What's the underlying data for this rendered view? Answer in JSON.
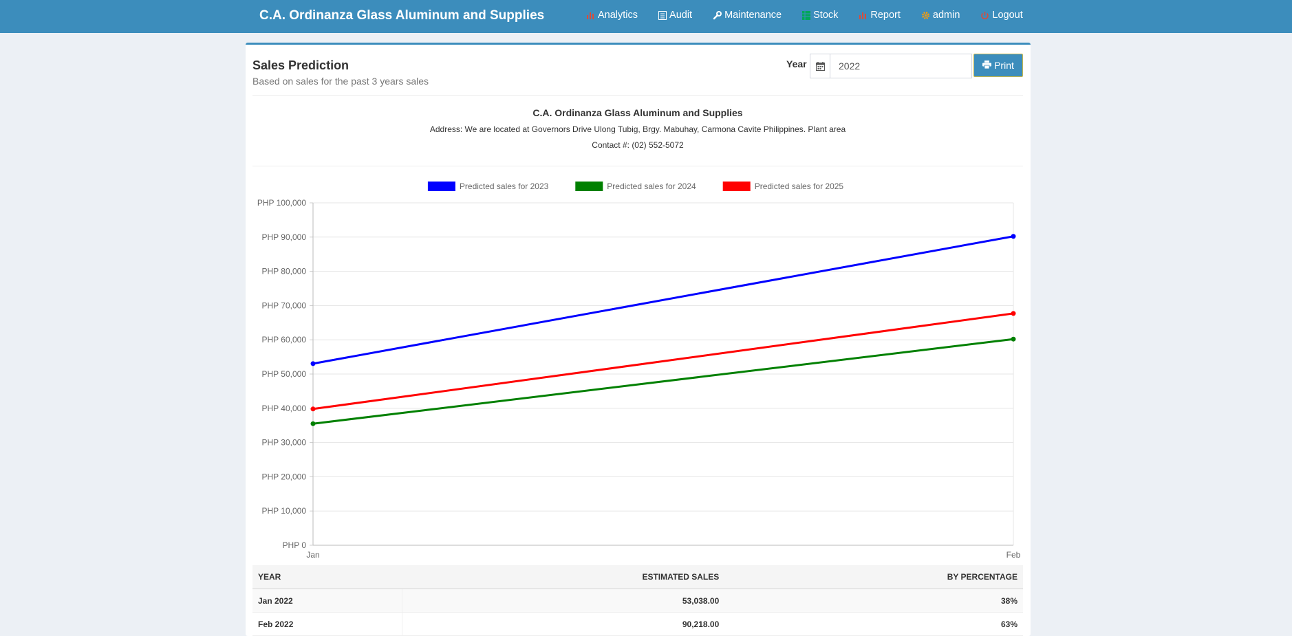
{
  "navbar": {
    "brand": "C.A. Ordinanza Glass Aluminum and Supplies",
    "items": [
      {
        "label": "Analytics",
        "icon": "bar-chart-icon",
        "color": "#dd4b39"
      },
      {
        "label": "Audit",
        "icon": "list-icon",
        "color": "#ffffff"
      },
      {
        "label": "Maintenance",
        "icon": "wrench-icon",
        "color": "#ffffff"
      },
      {
        "label": "Stock",
        "icon": "table-icon",
        "color": "#00a65a"
      },
      {
        "label": "Report",
        "icon": "bar-chart-icon",
        "color": "#dd4b39"
      },
      {
        "label": "admin",
        "icon": "gear-icon",
        "color": "#f39c12"
      },
      {
        "label": "Logout",
        "icon": "power-icon",
        "color": "#dd4b39"
      }
    ],
    "color": "#3c8dbc"
  },
  "box": {
    "title": "Sales Prediction",
    "subtitle": "Based on sales for the past 3 years sales",
    "year_label": "Year",
    "year_value": "2022",
    "print_label": "Print"
  },
  "company": {
    "name": "C.A. Ordinanza Glass Aluminum and Supplies",
    "address": "Address: We are located at Governors Drive Ulong Tubig, Brgy. Mabuhay, Carmona Cavite Philippines. Plant area",
    "contact": "Contact #: (02) 552-5072"
  },
  "chart_data": {
    "type": "line",
    "categories": [
      "Jan",
      "Feb"
    ],
    "series": [
      {
        "name": "Predicted sales for 2023",
        "values": [
          53038,
          90218
        ],
        "color": "#0000ff"
      },
      {
        "name": "Predicted sales for 2024",
        "values": [
          35500,
          60200
        ],
        "color": "#008000"
      },
      {
        "name": "Predicted sales for 2025",
        "values": [
          39800,
          67700
        ],
        "color": "#ff0000"
      }
    ],
    "ylim": [
      0,
      100000
    ],
    "yticks": [
      "PHP 0",
      "PHP 10,000",
      "PHP 20,000",
      "PHP 30,000",
      "PHP 40,000",
      "PHP 50,000",
      "PHP 60,000",
      "PHP 70,000",
      "PHP 80,000",
      "PHP 90,000",
      "PHP 100,000"
    ],
    "legend_position": "top-center",
    "grid": true
  },
  "table": {
    "headers": [
      "YEAR",
      "ESTIMATED SALES",
      "BY PERCENTAGE"
    ],
    "rows": [
      {
        "year": "Jan 2022",
        "sales": "53,038.00",
        "pct": "38%"
      },
      {
        "year": "Feb 2022",
        "sales": "90,218.00",
        "pct": "63%"
      }
    ]
  }
}
